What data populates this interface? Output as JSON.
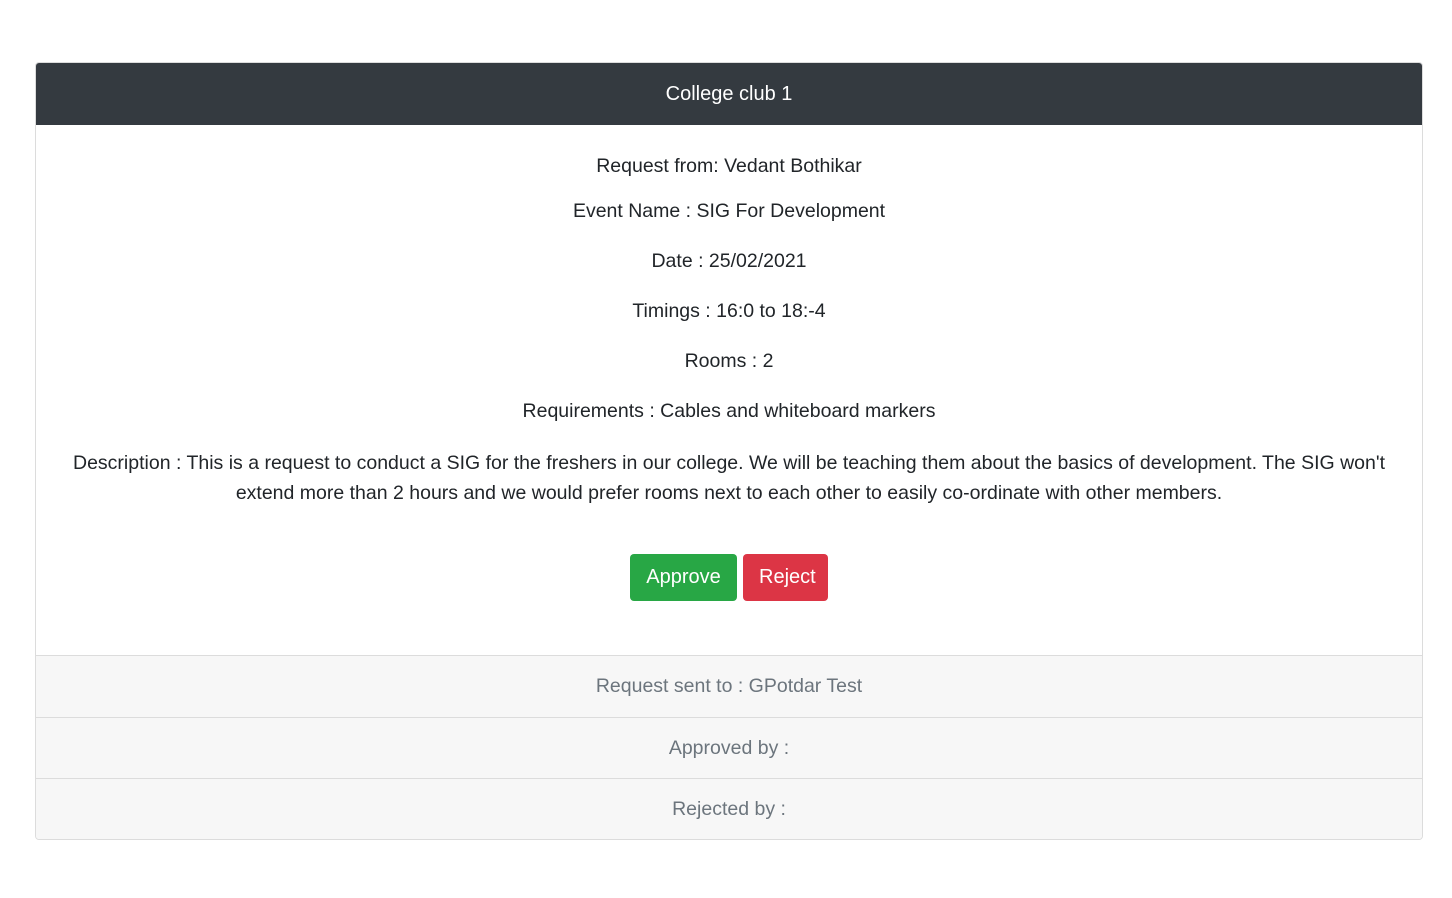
{
  "card": {
    "title": "College club 1",
    "request_from": "Request from: Vedant Bothikar",
    "event_name": "Event Name : SIG For Development",
    "date": "Date : 25/02/2021",
    "timings": "Timings : 16:0 to 18:-4",
    "rooms": "Rooms : 2",
    "requirements": "Requirements : Cables and whiteboard markers",
    "description": "Description : This is a request to conduct a SIG for the freshers in our college. We will be teaching them about the basics of development. The SIG won't extend more than 2 hours and we would prefer rooms next to each other to easily co-ordinate with other members.",
    "approve_label": "Approve",
    "reject_label": "Reject",
    "sent_to": "Request sent to : GPotdar Test",
    "approved_by": "Approved by :",
    "rejected_by": "Rejected by :"
  },
  "colors": {
    "header": "#343a40",
    "approve": "#28a745",
    "reject": "#dc3545"
  }
}
